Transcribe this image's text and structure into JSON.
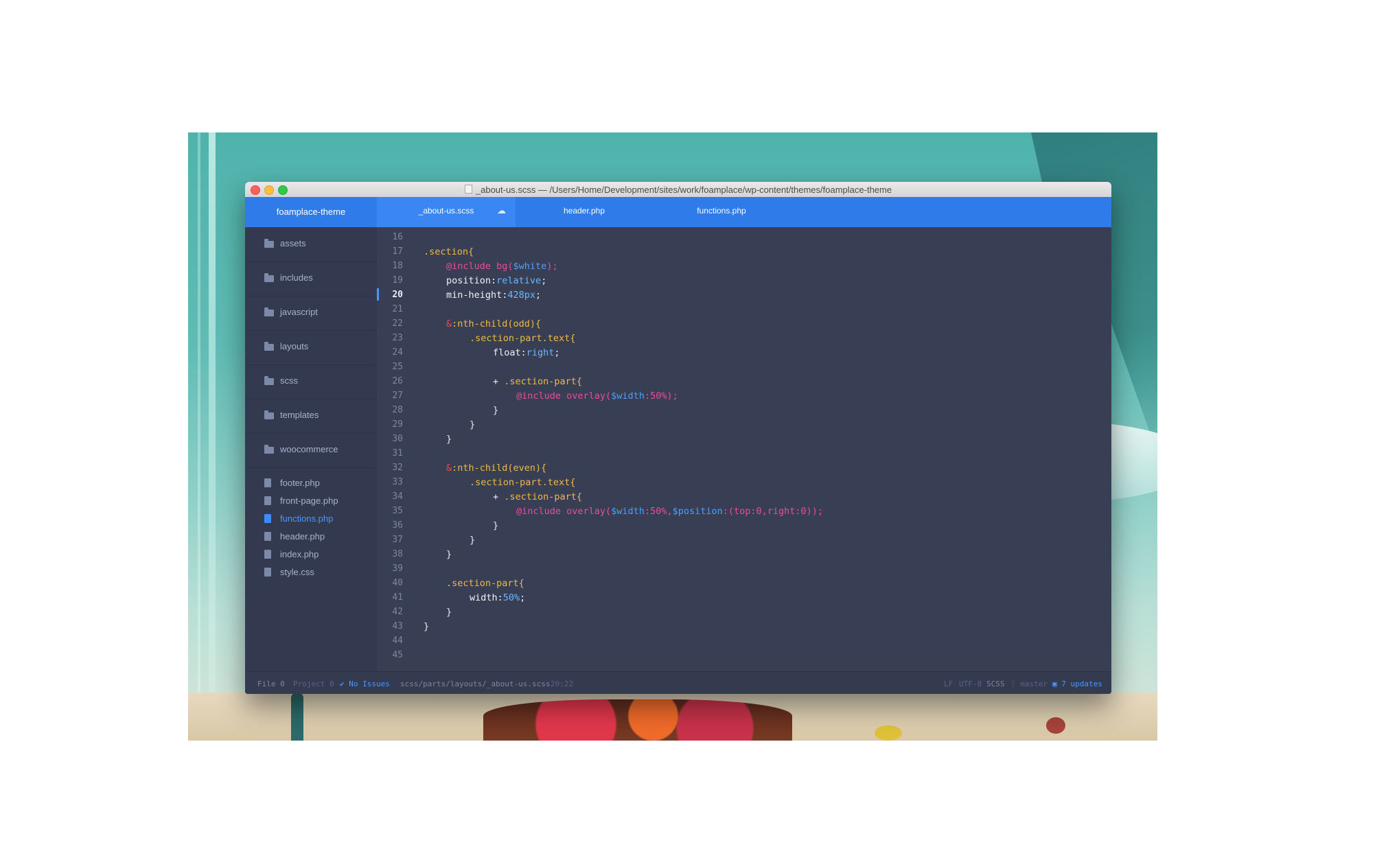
{
  "window": {
    "title": "_about-us.scss — /Users/Home/Development/sites/work/foamplace/wp-content/themes/foamplace-theme"
  },
  "header": {
    "project": "foamplace-theme",
    "tabs": [
      {
        "label": "_about-us.scss",
        "active": true,
        "icon": "cloud-icon"
      },
      {
        "label": "header.php",
        "active": false
      },
      {
        "label": "functions.php",
        "active": false
      }
    ]
  },
  "sidebar": {
    "folders": [
      "assets",
      "includes",
      "javascript",
      "layouts",
      "scss",
      "templates",
      "woocommerce"
    ],
    "files": [
      {
        "label": "footer.php"
      },
      {
        "label": "front-page.php"
      },
      {
        "label": "functions.php",
        "active": true
      },
      {
        "label": "header.php"
      },
      {
        "label": "index.php"
      },
      {
        "label": "style.css"
      }
    ]
  },
  "editor": {
    "current_line": 20,
    "line_numbers": [
      "16",
      "17",
      "18",
      "19",
      "20",
      "21",
      "22",
      "23",
      "24",
      "25",
      "26",
      "27",
      "28",
      "29",
      "30",
      "31",
      "32",
      "33",
      "34",
      "35",
      "36",
      "37",
      "38",
      "39",
      "40",
      "41",
      "42",
      "43",
      "44",
      "45"
    ],
    "code": {
      "l17": ".section{",
      "l18a": "@include bg(",
      "l18b": "$white",
      "l18c": ");",
      "l19a": "position:",
      "l19b": "relative",
      "l19c": ";",
      "l20a": "min-height:",
      "l20b": "428px",
      "l20c": ";",
      "l22a": "&",
      "l22b": ":nth-child(odd){",
      "l23": ".section-part.text{",
      "l24a": "float:",
      "l24b": "right",
      "l24c": ";",
      "l26a": "+ ",
      "l26b": ".section-part{",
      "l27a": "@include overlay(",
      "l27b": "$width",
      "l27c": ":50%",
      "l27d": ");",
      "l28": "}",
      "l29": "}",
      "l30": "}",
      "l32a": "&",
      "l32b": ":nth-child(even){",
      "l33": ".section-part.text{",
      "l34a": "+ ",
      "l34b": ".section-part{",
      "l35a": "@include overlay(",
      "l35b": "$width",
      "l35c": ":50%,",
      "l35d": "$position",
      "l35e": ":(top:0,right:0)",
      "l35f": ");",
      "l36": "}",
      "l37": "}",
      "l38": "}",
      "l40": ".section-part{",
      "l41a": "width:",
      "l41b": "50%",
      "l41c": ";",
      "l42": "}",
      "l43": "}"
    }
  },
  "status": {
    "file": "File 0",
    "project": "Project 0",
    "issues": "No Issues",
    "path": "scss/parts/layouts/_about-us.scss",
    "cursor": "20:22",
    "line_ending": "LF",
    "encoding": "UTF-8",
    "grammar": "SCSS",
    "branch": "master",
    "updates": "7 updates"
  },
  "colors": {
    "accent": "#2f7bea",
    "editor_bg": "#383f55",
    "sidebar_bg": "#333a4f",
    "selector": "#f2b942",
    "at_rule": "#ec4b9a",
    "variable": "#4f9dff"
  }
}
